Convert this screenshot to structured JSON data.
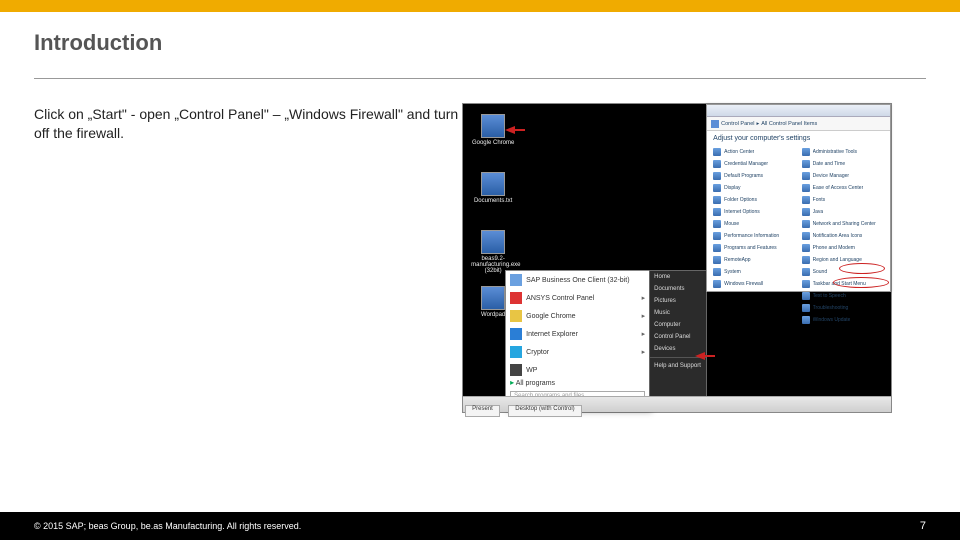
{
  "header": {
    "title": "Introduction"
  },
  "body": {
    "paragraph": "Click on „Start\"  - open „Control Panel\" – „Windows Firewall\" and turn off the firewall."
  },
  "desktop_icons": [
    {
      "label": "Google Chrome"
    },
    {
      "label": "Documents.txt"
    },
    {
      "label": "beas9.2-manufacturing.exe (32bit)"
    },
    {
      "label": "Wordpad"
    }
  ],
  "start_menu": {
    "items": [
      "SAP Business One Client (32-bit)",
      "ANSYS Control Panel",
      "Google Chrome",
      "Internet Explorer",
      "Cryptor",
      "WP"
    ],
    "all_label": "All programs",
    "search_placeholder": "Search programs and files"
  },
  "start_right": [
    "Home",
    "Documents",
    "Pictures",
    "Music",
    "Computer",
    "Control Panel",
    "Devices",
    "-",
    "Help and Support"
  ],
  "taskbar": {
    "b1": "Present",
    "b2": "Desktop (with Control)"
  },
  "control_panel": {
    "bc1": "Control Panel",
    "bc2": "All Control Panel Items",
    "heading": "Adjust your computer's settings",
    "items_left": [
      "Action Center",
      "Credential Manager",
      "Default Programs",
      "Display",
      "Folder Options",
      "Internet Options",
      "Mouse",
      "Performance Information",
      "Programs and Features",
      "RemoteApp",
      "System",
      "Windows Firewall"
    ],
    "items_right": [
      "Administrative Tools",
      "Date and Time",
      "Device Manager",
      "Ease of Access Center",
      "Fonts",
      "Java",
      "Network and Sharing Center",
      "Notification Area Icons",
      "Phone and Modem",
      "Region and Language",
      "Sound",
      "Taskbar and Start Menu",
      "Text to Speech",
      "Troubleshooting",
      "Windows Update"
    ]
  },
  "footer": {
    "copyright": "©  2015 SAP; beas Group, be.as Manufacturing.  All rights reserved.",
    "page": "7"
  }
}
